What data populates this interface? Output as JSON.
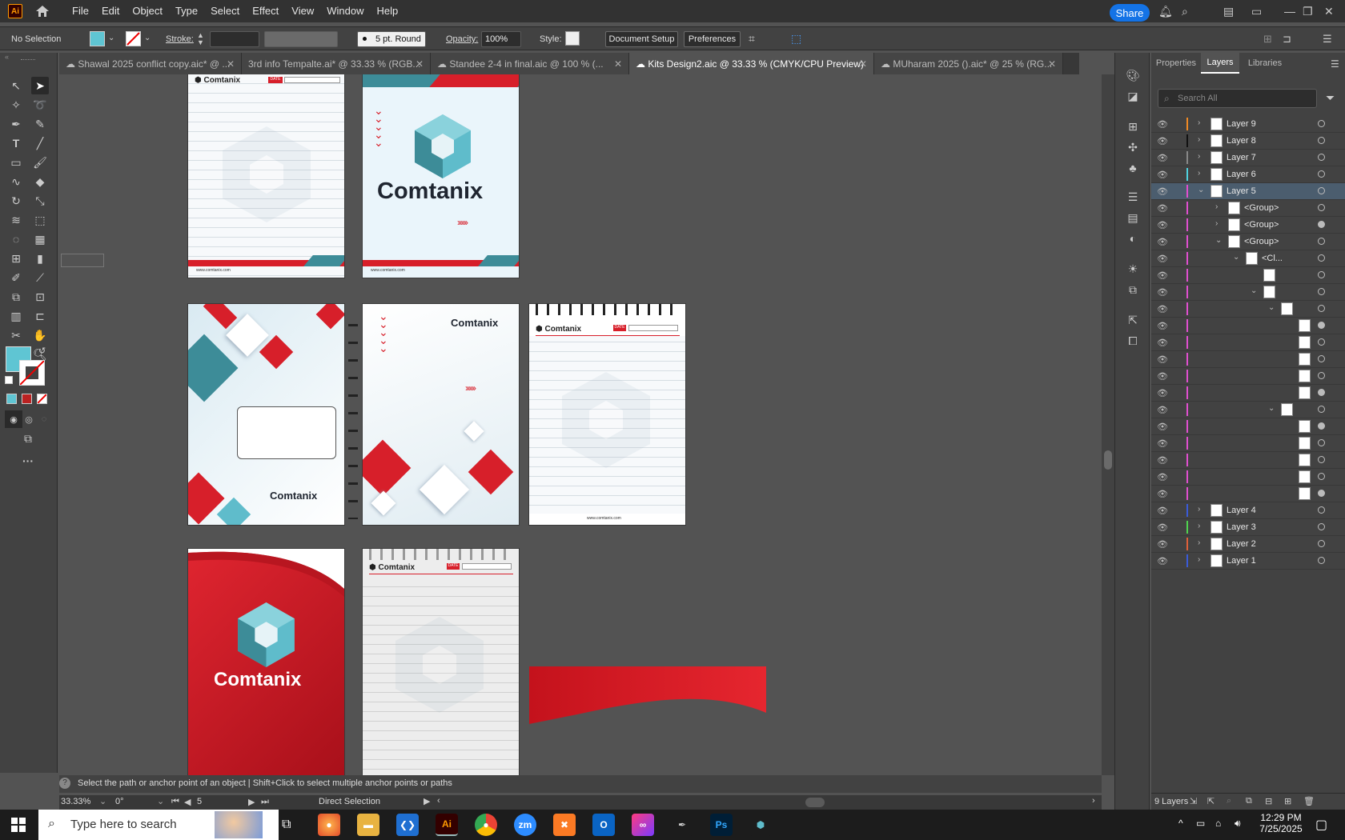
{
  "menu": [
    "File",
    "Edit",
    "Object",
    "Type",
    "Select",
    "Effect",
    "View",
    "Window",
    "Help"
  ],
  "app_logo": "Ai",
  "share_label": "Share",
  "control": {
    "selection": "No Selection",
    "stroke_label": "Stroke:",
    "brush": "5 pt. Round",
    "opacity_label": "Opacity:",
    "opacity_value": "100%",
    "style_label": "Style:",
    "doc_setup": "Document Setup",
    "preferences": "Preferences"
  },
  "tabs": [
    {
      "label": "Shawal 2025 conflict copy.aic* @ ..."
    },
    {
      "label": "3rd info Tempalte.ai* @ 33.33 % (RGB..."
    },
    {
      "label": "Standee 2-4 in final.aic @ 100 % (..."
    },
    {
      "label": "Kits Design2.aic @ 33.33 % (CMYK/CPU Preview)"
    },
    {
      "label": "MUharam 2025 ().aic* @ 25 % (RG..."
    }
  ],
  "brand": {
    "name": "Comtanix",
    "url": "www.comtanix.com",
    "date": "DATE",
    "red": "#d71f2a",
    "teal": "#3d8c98"
  },
  "fill_color": "#5fc5d3",
  "status": {
    "hint": "Select the path or anchor point of an object  |  Shift+Click to select multiple anchor points or paths",
    "zoom": "33.33%",
    "rotation": "0°",
    "artboard": "5",
    "tool": "Direct Selection"
  },
  "panel": {
    "tabs": [
      "Properties",
      "Layers",
      "Libraries"
    ],
    "search_placeholder": "Search All",
    "footer_count": "9 Layers",
    "layers": [
      {
        "name": "Layer 9",
        "color": "#f08a24",
        "indent": 0,
        "expand": "›",
        "circ": "o"
      },
      {
        "name": "Layer 8",
        "color": "#111111",
        "indent": 0,
        "expand": "›",
        "circ": "o"
      },
      {
        "name": "Layer 7",
        "color": "#888888",
        "indent": 0,
        "expand": "›",
        "circ": "o"
      },
      {
        "name": "Layer 6",
        "color": "#4fd3e0",
        "indent": 0,
        "expand": "›",
        "circ": "o"
      },
      {
        "name": "Layer 5",
        "color": "#e04fd0",
        "indent": 0,
        "expand": "⌄",
        "circ": "o",
        "sel": true
      },
      {
        "name": "<Group>",
        "color": "#e04fd0",
        "indent": 1,
        "expand": "›",
        "circ": "o"
      },
      {
        "name": "<Group>",
        "color": "#e04fd0",
        "indent": 1,
        "expand": "›",
        "circ": "f"
      },
      {
        "name": "<Group>",
        "color": "#e04fd0",
        "indent": 1,
        "expand": "⌄",
        "circ": "o"
      },
      {
        "name": "<Cl...",
        "color": "#e04fd0",
        "indent": 2,
        "expand": "⌄",
        "circ": "o"
      },
      {
        "name": "",
        "color": "#e04fd0",
        "indent": 3,
        "expand": "",
        "circ": "o"
      },
      {
        "name": "",
        "color": "#e04fd0",
        "indent": 3,
        "expand": "⌄",
        "circ": "o"
      },
      {
        "name": "",
        "color": "#e04fd0",
        "indent": 4,
        "expand": "⌄",
        "circ": "o"
      },
      {
        "name": "",
        "color": "#e04fd0",
        "indent": 5,
        "expand": "",
        "circ": "f"
      },
      {
        "name": "",
        "color": "#e04fd0",
        "indent": 5,
        "expand": "",
        "circ": "o"
      },
      {
        "name": "",
        "color": "#e04fd0",
        "indent": 5,
        "expand": "",
        "circ": "o"
      },
      {
        "name": "",
        "color": "#e04fd0",
        "indent": 5,
        "expand": "",
        "circ": "o"
      },
      {
        "name": "",
        "color": "#e04fd0",
        "indent": 5,
        "expand": "",
        "circ": "f"
      },
      {
        "name": "",
        "color": "#e04fd0",
        "indent": 4,
        "expand": "⌄",
        "circ": "o"
      },
      {
        "name": "",
        "color": "#e04fd0",
        "indent": 5,
        "expand": "",
        "circ": "f"
      },
      {
        "name": "",
        "color": "#e04fd0",
        "indent": 5,
        "expand": "",
        "circ": "o"
      },
      {
        "name": "",
        "color": "#e04fd0",
        "indent": 5,
        "expand": "",
        "circ": "o"
      },
      {
        "name": "",
        "color": "#e04fd0",
        "indent": 5,
        "expand": "",
        "circ": "o"
      },
      {
        "name": "",
        "color": "#e04fd0",
        "indent": 5,
        "expand": "",
        "circ": "f"
      },
      {
        "name": "Layer 4",
        "color": "#3a5bd9",
        "indent": 0,
        "expand": "›",
        "circ": "o"
      },
      {
        "name": "Layer 3",
        "color": "#4fd34f",
        "indent": 0,
        "expand": "›",
        "circ": "o"
      },
      {
        "name": "Layer 2",
        "color": "#e0603a",
        "indent": 0,
        "expand": "›",
        "circ": "o"
      },
      {
        "name": "Layer 1",
        "color": "#3a5bd9",
        "indent": 0,
        "expand": "›",
        "circ": "o"
      }
    ]
  },
  "taskbar": {
    "search_placeholder": "Type here to search",
    "time": "12:29 PM",
    "date": "7/25/2025",
    "apps": [
      "firefox",
      "explorer",
      "vscode",
      "illustrator",
      "chrome",
      "zoom",
      "xampp",
      "outlook",
      "creative-cloud",
      "pen",
      "photoshop",
      "app"
    ]
  }
}
